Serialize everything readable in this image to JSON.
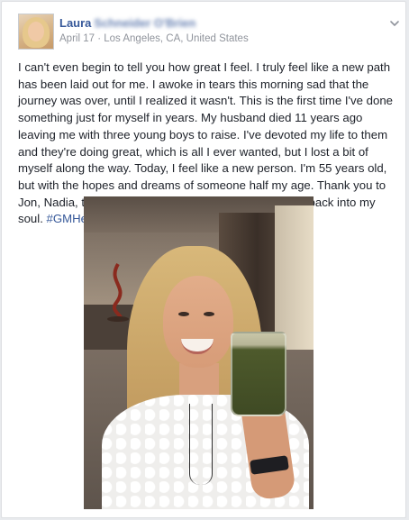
{
  "post": {
    "author_first_name": "Laura",
    "author_last_name_blurred": "Schneider O'Brien",
    "date": "April 17",
    "separator": "·",
    "location": "Los Angeles, CA, United States",
    "body": "I can't even begin to tell you how great I feel. I truly feel like a new path has been laid out for me. I awoke in tears this morning sad that the journey was over, until I realized it wasn't. This is the first time I've done something just for myself in years. My husband died 11 years ago leaving me with three young boys to raise. I've devoted my life to them and they're doing great, which is all I ever wanted, but I lost a bit of myself along the way. Today, I feel like a new person. I'm 55 years old, but with the hopes and dreams of someone half my age. Thank you to Jon, Nadia, the GM team and all of you for bringing life back into my soul.",
    "hashtag": "#GMHeatlhySelfie"
  },
  "icons": {
    "options": "chevron-down-icon"
  },
  "colors": {
    "link_blue": "#365899",
    "meta_gray": "#90949c",
    "text": "#1d2129"
  }
}
